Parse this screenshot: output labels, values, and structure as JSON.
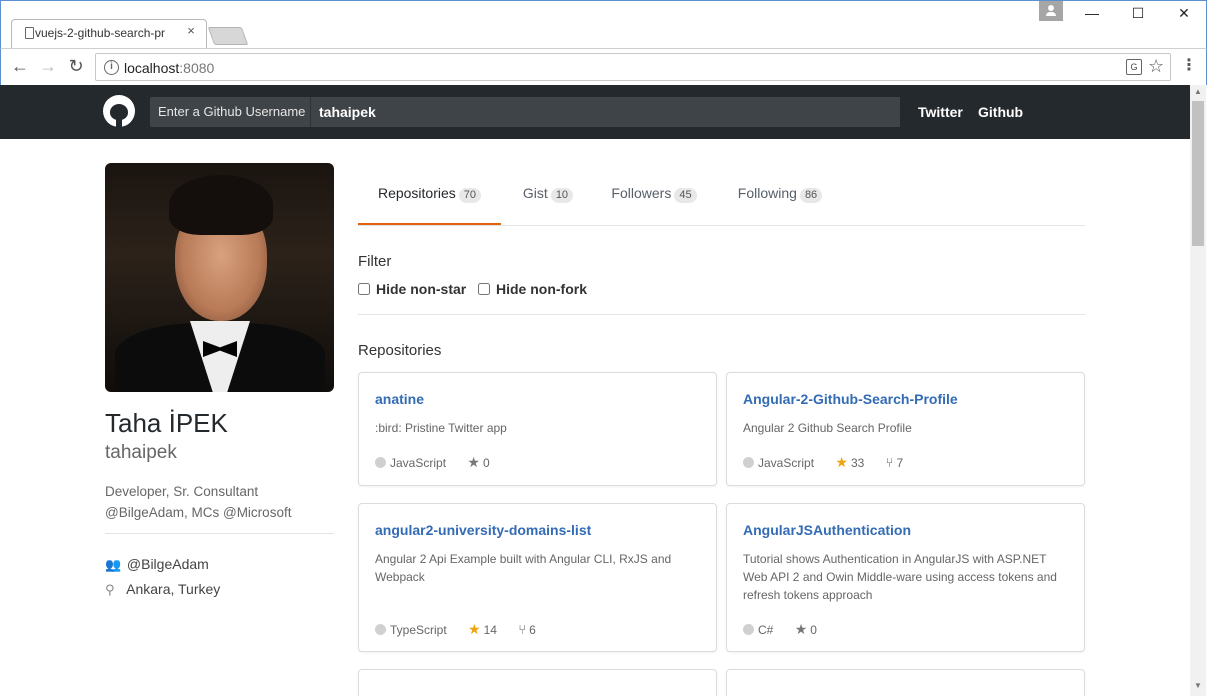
{
  "browser": {
    "tab_title": "vuejs-2-github-search-pr",
    "tab_close": "×",
    "url_host": "localhost",
    "url_port": ":8080",
    "win_minimize": "—",
    "win_maximize": "☐",
    "win_close": "✕",
    "back": "←",
    "forward": "→",
    "reload": "↻",
    "info": "i",
    "translate": "G",
    "bookmark": "☆",
    "menu": "⋮"
  },
  "navbar": {
    "search_label": "Enter a Github Username",
    "search_value": "tahaipek",
    "links": [
      "Twitter",
      "Github"
    ]
  },
  "profile": {
    "name": "Taha İPEK",
    "username": "tahaipek",
    "bio": "Developer, Sr. Consultant @BilgeAdam, MCs @Microsoft",
    "company": "@BilgeAdam",
    "location": "Ankara, Turkey",
    "company_icon": "👥",
    "location_icon": "⚲"
  },
  "tabs": [
    {
      "label": "Repositories",
      "count": "70"
    },
    {
      "label": "Gist",
      "count": "10"
    },
    {
      "label": "Followers",
      "count": "45"
    },
    {
      "label": "Following",
      "count": "86"
    }
  ],
  "filter": {
    "title": "Filter",
    "hide_non_star": "Hide non-star",
    "hide_non_fork": "Hide non-fork"
  },
  "repos_title": "Repositories",
  "repos": [
    {
      "name": "anatine",
      "desc": ":bird: Pristine Twitter app",
      "lang": "JavaScript",
      "stars": "0",
      "forks": ""
    },
    {
      "name": "Angular-2-Github-Search-Profile",
      "desc": "Angular 2 Github Search Profile",
      "lang": "JavaScript",
      "stars": "33",
      "forks": "7"
    },
    {
      "name": "angular2-university-domains-list",
      "desc": "Angular 2 Api Example built with Angular CLI, RxJS and Webpack",
      "lang": "TypeScript",
      "stars": "14",
      "forks": "6"
    },
    {
      "name": "AngularJSAuthentication",
      "desc": "Tutorial shows Authentication in AngularJS with ASP.NET Web API 2 and Owin Middle-ware using access tokens and refresh tokens approach",
      "lang": "C#",
      "stars": "0",
      "forks": ""
    }
  ],
  "icons": {
    "star": "★",
    "fork": "⑂",
    "scroll_up": "▲",
    "scroll_down": "▼"
  },
  "colors": {
    "navbar_bg": "#24292e",
    "link": "#336bb5",
    "active_tab_underline": "#e36209",
    "star_highlight": "#f0a30a"
  }
}
